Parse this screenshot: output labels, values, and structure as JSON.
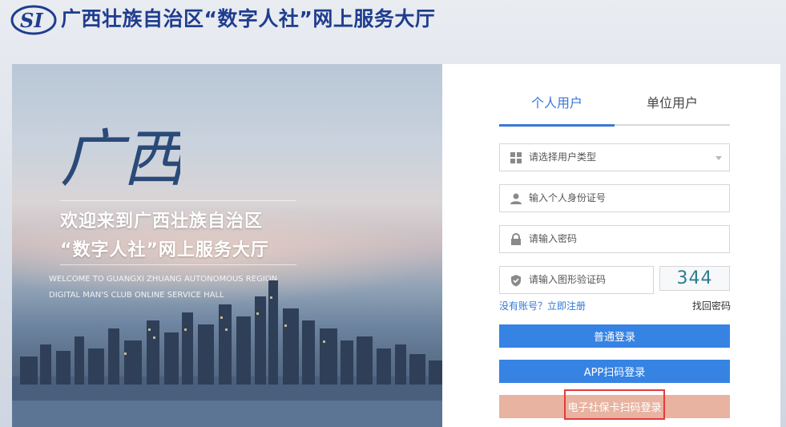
{
  "header": {
    "logo_text": "SI",
    "title": "广西壮族自治区“数字人社”网上服务大厅"
  },
  "hero": {
    "calligraphy": "广西",
    "welcome_line1": "欢迎来到广西壮族自治区",
    "welcome_line2": "“数字人社”网上服务大厅",
    "english_line1": "WELCOME TO GUANGXI ZHUANG AUTONOMOUS REGION",
    "english_line2": "DIGITAL MAN'S CLUB ONLINE SERVICE HALL"
  },
  "login": {
    "tabs": [
      {
        "label": "个人用户",
        "active": true
      },
      {
        "label": "单位用户",
        "active": false
      }
    ],
    "user_type_placeholder": "请选择用户类型",
    "id_placeholder": "输入个人身份证号",
    "password_placeholder": "请输入密码",
    "captcha_placeholder": "请输入图形验证码",
    "captcha_code": "344",
    "register_link": "没有账号？立即注册",
    "forgot_link": "找回密码",
    "buttons": {
      "normal_login": "普通登录",
      "app_scan_login": "APP扫码登录",
      "card_scan_login": "电子社保卡扫码登录"
    }
  },
  "colors": {
    "brand_blue": "#1f3d8f",
    "accent_blue": "#3683e3",
    "card_button": "#e8b3a0",
    "highlight_red": "#e43b3b"
  }
}
